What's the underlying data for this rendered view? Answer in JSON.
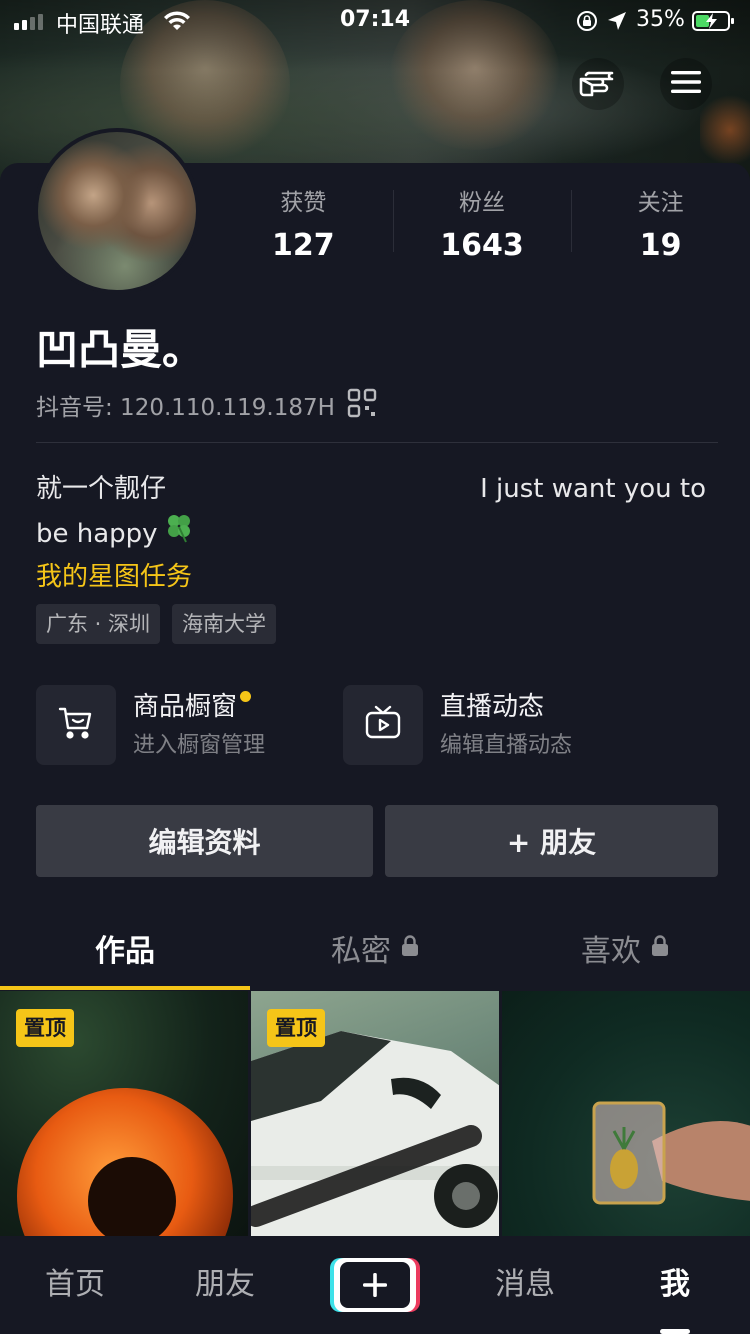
{
  "status_bar": {
    "carrier": "中国联通",
    "time": "07:14",
    "battery_percent": "35%"
  },
  "profile": {
    "nickname": "凹凸曼。",
    "douyin_id": "抖音号: 120.110.119.187H",
    "stats": [
      {
        "label": "获赞",
        "value": "127"
      },
      {
        "label": "粉丝",
        "value": "1643"
      },
      {
        "label": "关注",
        "value": "19"
      }
    ],
    "bio": {
      "line1_left": "就一个靓仔",
      "line1_right": "I just want you to",
      "line2": "be happy"
    },
    "star_task": "我的星图任务",
    "tags": [
      "广东 · 深圳",
      "海南大学"
    ]
  },
  "features": [
    {
      "title": "商品橱窗",
      "subtitle": "进入橱窗管理",
      "icon": "cart-icon",
      "has_dot": true
    },
    {
      "title": "直播动态",
      "subtitle": "编辑直播动态",
      "icon": "tv-icon",
      "has_dot": false
    }
  ],
  "actions": {
    "edit_profile": "编辑资料",
    "add_friend": "+ 朋友"
  },
  "content_tabs": [
    {
      "label": "作品",
      "active": true,
      "locked": false
    },
    {
      "label": "私密",
      "active": false,
      "locked": true
    },
    {
      "label": "喜欢",
      "active": false,
      "locked": true
    }
  ],
  "grid": [
    {
      "badge": "置顶"
    },
    {
      "badge": "置顶"
    },
    {
      "badge": ""
    }
  ],
  "bottom_nav": {
    "home": "首页",
    "friends": "朋友",
    "messages": "消息",
    "me": "我"
  },
  "colors": {
    "background": "#161823",
    "accent_yellow": "#f5c518",
    "button_gray": "#393b44",
    "create_cyan": "#3de1e9",
    "create_red": "#ec3a5e"
  }
}
